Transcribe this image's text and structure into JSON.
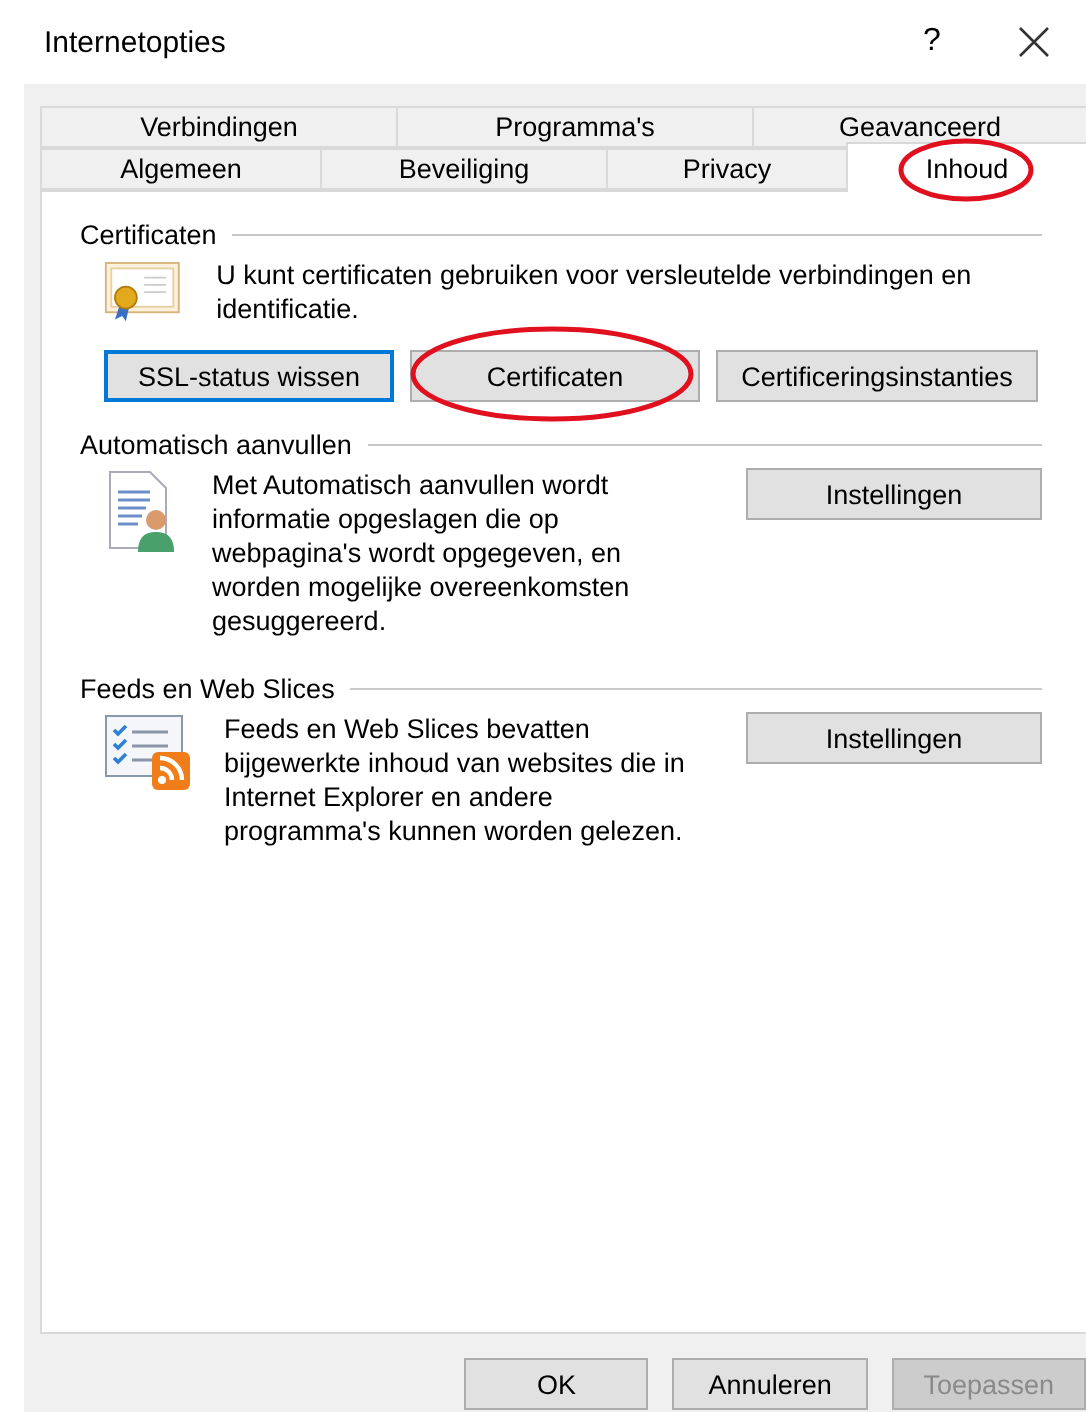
{
  "window": {
    "title": "Internetopties",
    "help": "?"
  },
  "tab_rows": [
    [
      {
        "label": "Verbindingen",
        "selected": false,
        "circled": false
      },
      {
        "label": "Programma's",
        "selected": false,
        "circled": false
      },
      {
        "label": "Geavanceerd",
        "selected": false,
        "circled": false
      }
    ],
    [
      {
        "label": "Algemeen",
        "selected": false,
        "circled": false
      },
      {
        "label": "Beveiliging",
        "selected": false,
        "circled": false
      },
      {
        "label": "Privacy",
        "selected": false,
        "circled": false
      },
      {
        "label": "Inhoud",
        "selected": true,
        "circled": true
      }
    ]
  ],
  "sections": [
    {
      "kind": "below",
      "title": "Certificaten",
      "text": "U kunt certificaten gebruiken voor versleutelde verbindingen en identificatie.",
      "buttons": [
        {
          "label": "SSL-status wissen",
          "focused": true,
          "circled": false
        },
        {
          "label": "Certificaten",
          "focused": false,
          "circled": true
        },
        {
          "label": "Certificeringsinstanties",
          "focused": false,
          "circled": false
        }
      ]
    },
    {
      "kind": "side",
      "title": "Automatisch aanvullen",
      "text": "Met Automatisch aanvullen wordt informatie opgeslagen die op webpagina's wordt opgegeven, en worden mogelijke overeenkomsten gesuggereerd.",
      "buttons": [
        {
          "label": "Instellingen",
          "focused": false,
          "circled": false
        }
      ]
    },
    {
      "kind": "side",
      "title": "Feeds en Web Slices",
      "text": "Feeds en Web Slices bevatten bijgewerkte inhoud van websites die in Internet Explorer en andere programma's kunnen worden gelezen.",
      "buttons": [
        {
          "label": "Instellingen",
          "focused": false,
          "circled": false
        }
      ]
    }
  ],
  "footer": [
    {
      "label": "OK",
      "disabled": false
    },
    {
      "label": "Annuleren",
      "disabled": false
    },
    {
      "label": "Toepassen",
      "disabled": true
    }
  ]
}
